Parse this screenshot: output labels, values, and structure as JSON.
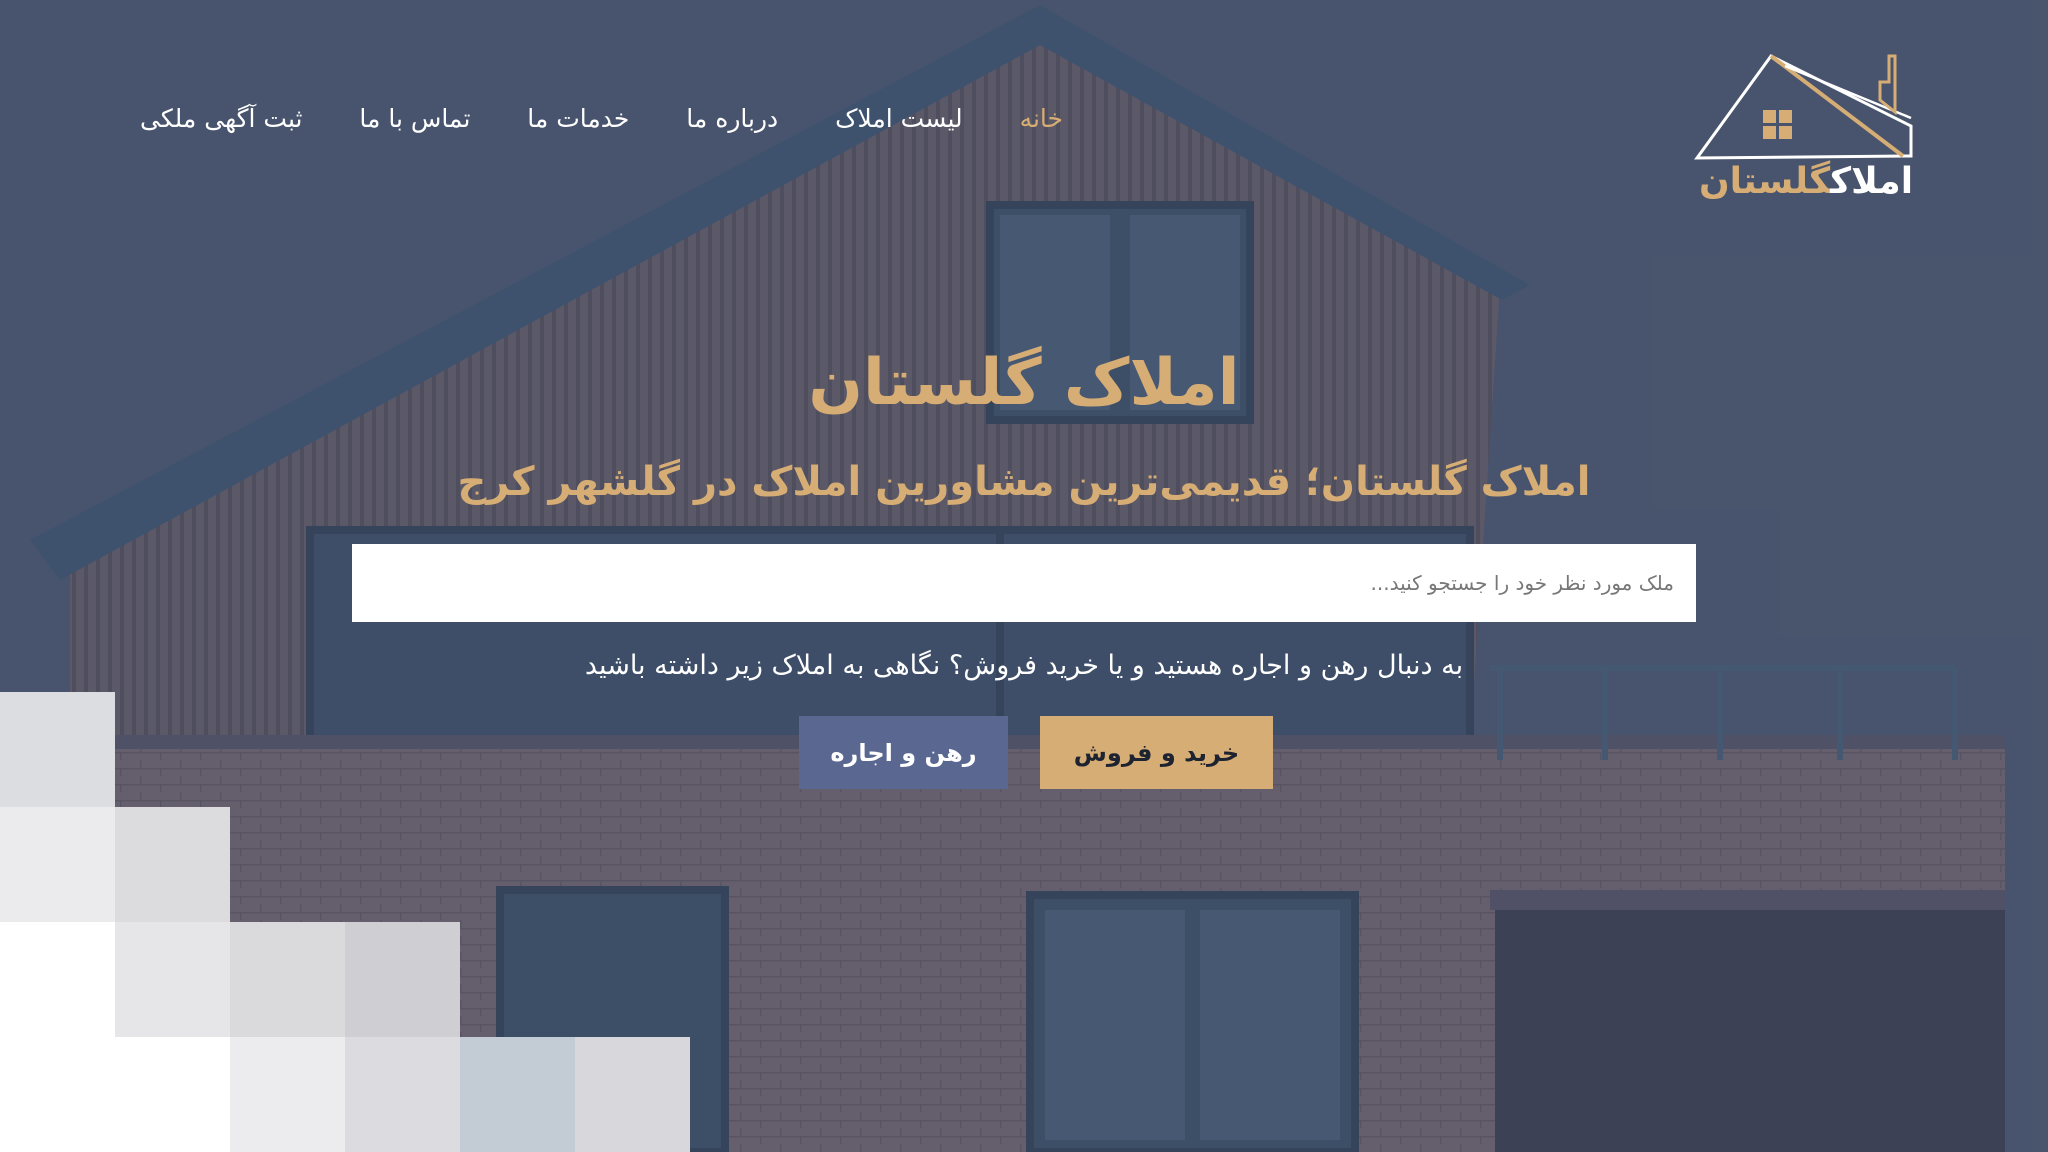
{
  "brand": {
    "logo_text_a": "املاک",
    "logo_text_b": "گلستان"
  },
  "nav": {
    "items": [
      {
        "label": "خانه",
        "active": true
      },
      {
        "label": "لیست املاک",
        "active": false
      },
      {
        "label": "درباره ما",
        "active": false
      },
      {
        "label": "خدمات ما",
        "active": false
      },
      {
        "label": "تماس با ما",
        "active": false
      },
      {
        "label": "ثبت آگهی ملکی",
        "active": false
      }
    ]
  },
  "hero": {
    "title": "املاک گلستان",
    "subtitle": "املاک گلستان؛ قدیمی‌ترین مشاورین املاک در گلشهر کرج",
    "search_placeholder": "ملک مورد نظر خود را جستجو کنید...",
    "search_value": "",
    "lead": "به دنبال رهن و اجاره هستید و یا خرید فروش؟ نگاهی به املاک زیر داشته باشید",
    "buy_button": "خرید و فروش",
    "rent_button": "رهن و اجاره"
  },
  "colors": {
    "accent_gold": "#d6ad74",
    "rent_button": "#5a6891",
    "overlay": "#4a5468"
  },
  "icons": {
    "logo": "house-roof-logo-icon"
  }
}
